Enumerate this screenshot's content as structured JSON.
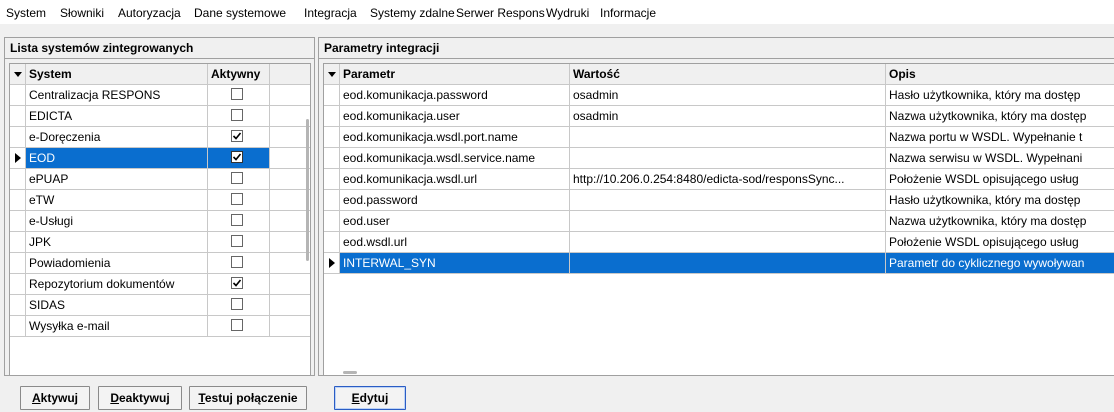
{
  "menu": [
    "System",
    "Słowniki",
    "Autoryzacja",
    "Dane systemowe",
    "Integracja",
    "Systemy zdalne",
    "Serwer Respons",
    "Wydruki",
    "Informacje"
  ],
  "left_panel": {
    "title": "Lista systemów zintegrowanych",
    "columns": [
      "System",
      "Aktywny"
    ],
    "rows": [
      {
        "name": "Centralizacja RESPONS",
        "active": false
      },
      {
        "name": "EDICTA",
        "active": false
      },
      {
        "name": "e-Doręczenia",
        "active": true
      },
      {
        "name": "EOD",
        "active": true,
        "selected": true
      },
      {
        "name": "ePUAP",
        "active": false
      },
      {
        "name": "eTW",
        "active": false
      },
      {
        "name": "e-Usługi",
        "active": false
      },
      {
        "name": "JPK",
        "active": false
      },
      {
        "name": "Powiadomienia",
        "active": false
      },
      {
        "name": "Repozytorium dokumentów",
        "active": true
      },
      {
        "name": "SIDAS",
        "active": false
      },
      {
        "name": "Wysyłka e-mail",
        "active": false
      }
    ],
    "buttons": {
      "activate": {
        "hot": "A",
        "rest": "ktywuj"
      },
      "deactivate": {
        "hot": "D",
        "rest": "eaktywuj"
      },
      "test": {
        "hot": "T",
        "rest": "estuj połączenie"
      }
    }
  },
  "right_panel": {
    "title": "Parametry integracji",
    "columns": [
      "Parametr",
      "Wartość",
      "Opis"
    ],
    "rows": [
      {
        "param": "eod.komunikacja.password",
        "value": "osadmin",
        "desc": "Hasło użytkownika, który ma dostęp"
      },
      {
        "param": "eod.komunikacja.user",
        "value": "osadmin",
        "desc": "Nazwa użytkownika, który ma dostęp"
      },
      {
        "param": "eod.komunikacja.wsdl.port.name",
        "value": "",
        "desc": "Nazwa portu w WSDL. Wypełnanie t"
      },
      {
        "param": "eod.komunikacja.wsdl.service.name",
        "value": "",
        "desc": "Nazwa serwisu w WSDL. Wypełnani"
      },
      {
        "param": "eod.komunikacja.wsdl.url",
        "value": "http://10.206.0.254:8480/edicta-sod/responsSync...",
        "desc": "Położenie WSDL opisującego usług"
      },
      {
        "param": "eod.password",
        "value": "",
        "desc": "Hasło użytkownika, który ma dostęp"
      },
      {
        "param": "eod.user",
        "value": "",
        "desc": "Nazwa użytkownika, który ma dostęp"
      },
      {
        "param": "eod.wsdl.url",
        "value": "",
        "desc": "Położenie WSDL opisującego usług"
      },
      {
        "param": "INTERWAL_SYN",
        "value": "",
        "desc": "Parametr do cyklicznego wywoływan",
        "selected": true
      }
    ],
    "buttons": {
      "edit": {
        "hot": "E",
        "rest": "dytuj"
      }
    }
  }
}
